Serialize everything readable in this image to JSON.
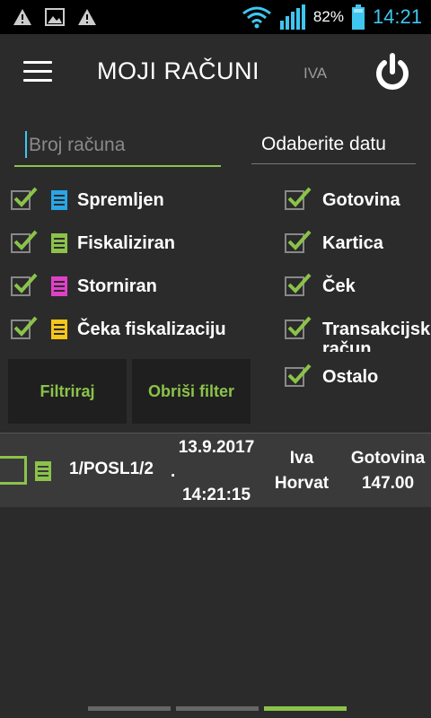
{
  "status_bar": {
    "battery_percent": "82%",
    "time": "14:21",
    "icons": [
      "warning-icon",
      "image-icon",
      "warning-icon",
      "wifi-icon",
      "signal-icon",
      "battery-icon"
    ]
  },
  "header": {
    "title": "MOJI RAČUNI",
    "user_initials": "IVA",
    "icons": [
      "menu-icon",
      "power-icon"
    ]
  },
  "filters": {
    "search_placeholder": "Broj računa",
    "date_label": "Odaberite datu",
    "statuses": [
      {
        "label": "Spremljen",
        "color": "#2aa6e8",
        "checked": true
      },
      {
        "label": "Fiskaliziran",
        "color": "#8bc34a",
        "checked": true
      },
      {
        "label": "Storniran",
        "color": "#e040c8",
        "checked": true
      },
      {
        "label": "Čeka fiskalizaciju",
        "color": "#f5c518",
        "checked": true
      }
    ],
    "payments": [
      {
        "label": "Gotovina",
        "checked": true
      },
      {
        "label": "Kartica",
        "checked": true
      },
      {
        "label": "Ček",
        "checked": true
      },
      {
        "label": "Transakcijski račun",
        "checked": true
      },
      {
        "label": "Ostalo",
        "checked": true
      }
    ],
    "filter_button": "Filtriraj",
    "clear_button": "Obriši filter"
  },
  "receipts": [
    {
      "number": "1/POSL1/2",
      "date": "13.9.2017",
      "separator": ".",
      "time": "14:21:15",
      "name_first": "Iva",
      "name_last": "Horvat",
      "payment": "Gotovina",
      "amount": "147.00",
      "status_color": "#8bc34a"
    }
  ],
  "pager": {
    "pages": 3,
    "active": 2
  },
  "colors": {
    "accent": "#8bc34a",
    "clock": "#3fc6f0",
    "background": "#2b2b2b"
  }
}
